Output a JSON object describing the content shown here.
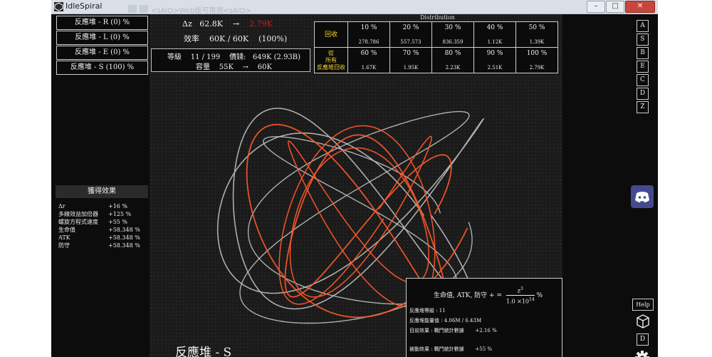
{
  "window": {
    "title": "IdleSpiral",
    "ghost_tab_text": "<sAlO>Web版可用测<sAlO>",
    "controls": [
      "–",
      "□",
      "✕"
    ]
  },
  "reactors": [
    "反應堆 - R (0) %",
    "反應堆 - L (0) %",
    "反應堆 - E (0) %",
    "反應堆 - S (100) %"
  ],
  "stats": {
    "delta_label": "Δz",
    "delta_value": "62.8K",
    "arrow": "→",
    "delta_target": "2.79K",
    "efficiency_label": "效率",
    "efficiency_value": "60K / 60K",
    "efficiency_pct": "(100%)"
  },
  "level": {
    "level_label": "等級",
    "level_value": "11 / 199",
    "price_label": "價錢:",
    "price_value": "649K (2.93B)",
    "capacity_label": "容量",
    "capacity_value": "55K",
    "capacity_arrow": "→",
    "capacity_target": "60K"
  },
  "distribution": {
    "title": "Distribution",
    "row_headers": [
      "回收",
      "從\n所有\n反應堆回收"
    ],
    "rows": [
      [
        {
          "pct": "10 %",
          "val": "278.786"
        },
        {
          "pct": "20 %",
          "val": "557.573"
        },
        {
          "pct": "30 %",
          "val": "836.359"
        },
        {
          "pct": "40 %",
          "val": "1.12K"
        },
        {
          "pct": "50 %",
          "val": "1.39K"
        }
      ],
      [
        {
          "pct": "60 %",
          "val": "1.67K"
        },
        {
          "pct": "70 %",
          "val": "1.95K"
        },
        {
          "pct": "80 %",
          "val": "2.23K"
        },
        {
          "pct": "90 %",
          "val": "2.51K"
        },
        {
          "pct": "100 %",
          "val": "2.79K"
        }
      ]
    ]
  },
  "side_buttons": [
    "A",
    "S",
    "B",
    "E",
    "C",
    "D",
    "Z"
  ],
  "icons": {
    "discord": "discord-icon",
    "cube": "cube-icon",
    "gear": "gear-icon"
  },
  "help_label": "Help",
  "d_label": "D",
  "effects": {
    "title": "獲得效果",
    "items": [
      {
        "name": "Δr",
        "value": "+16 %"
      },
      {
        "name": "多線效益加倍器",
        "value": "+125 %"
      },
      {
        "name": "螺旋方程式速度",
        "value": "+55 %"
      },
      {
        "name": "生命值",
        "value": "+58.348 %"
      },
      {
        "name": "ATK",
        "value": "+58.348 %"
      },
      {
        "name": "防守",
        "value": "+58.348 %"
      }
    ]
  },
  "info": {
    "formula_text": "生命值, ATK, 防守 + =",
    "formula_numerator": "z",
    "formula_exp_top": "3",
    "formula_denominator": "1.0 ×10",
    "formula_exp_bottom": "14",
    "formula_suffix": "%",
    "level_line": "反應堆等級 : 11",
    "capacity_line": "反應堆能量值 : 4.06M / 6.43M",
    "current_label": "目前效果 : 戰鬥統計數據",
    "current_value": "+2.16 %",
    "passive_label": "被動效果 : 戰鬥統計數據",
    "passive_value": "+55 %"
  },
  "reactor_name": "反應堆 - S",
  "colors": {
    "accent_red": "#d81b1b",
    "curve_orange": "#ff5a2a",
    "curve_white": "#bfbfbf",
    "highlight_yellow": "#f5d020"
  }
}
